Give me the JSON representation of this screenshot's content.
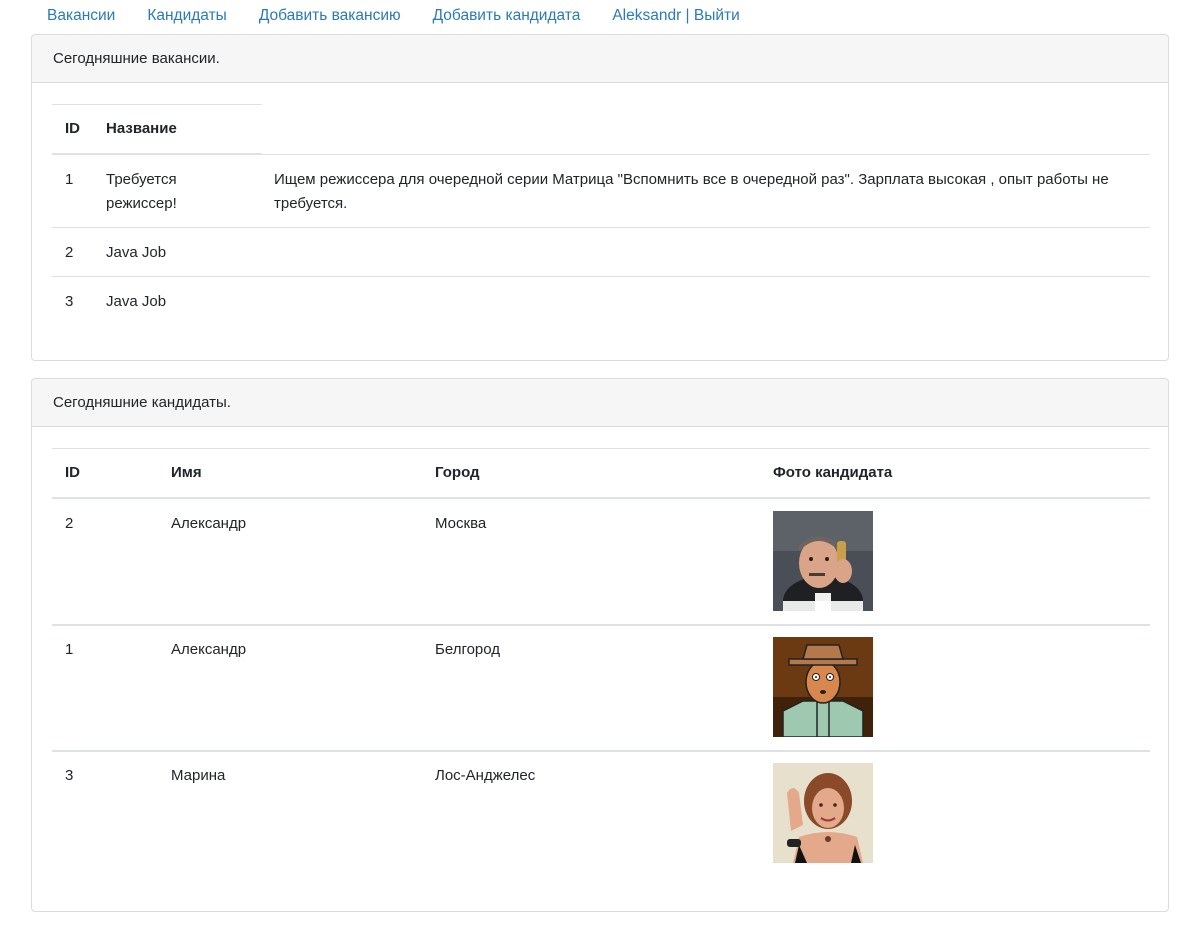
{
  "nav": {
    "items": [
      "Вакансии",
      "Кандидаты",
      "Добавить вакансию",
      "Добавить кандидата",
      "Aleksandr | Выйти"
    ]
  },
  "vacancies": {
    "header": "Сегодняшние вакансии.",
    "columns": [
      "ID",
      "Название"
    ],
    "rows": [
      {
        "id": "1",
        "name": "Требуется режиссер!",
        "description": "Ищем режиссера для очередной серии Матрица \"Вспомнить все в очередной раз\". Зарплата высокая , опыт работы не требуется."
      },
      {
        "id": "2",
        "name": "Java Job",
        "description": ""
      },
      {
        "id": "3",
        "name": "Java Job",
        "description": ""
      }
    ]
  },
  "candidates": {
    "header": "Сегодняшние кандидаты.",
    "columns": [
      "ID",
      "Имя",
      "Город",
      "Фото кандидата"
    ],
    "rows": [
      {
        "id": "2",
        "name": "Александр",
        "city": "Москва"
      },
      {
        "id": "1",
        "name": "Александр",
        "city": "Белгород"
      },
      {
        "id": "3",
        "name": "Марина",
        "city": "Лос-Анджелес"
      }
    ]
  }
}
